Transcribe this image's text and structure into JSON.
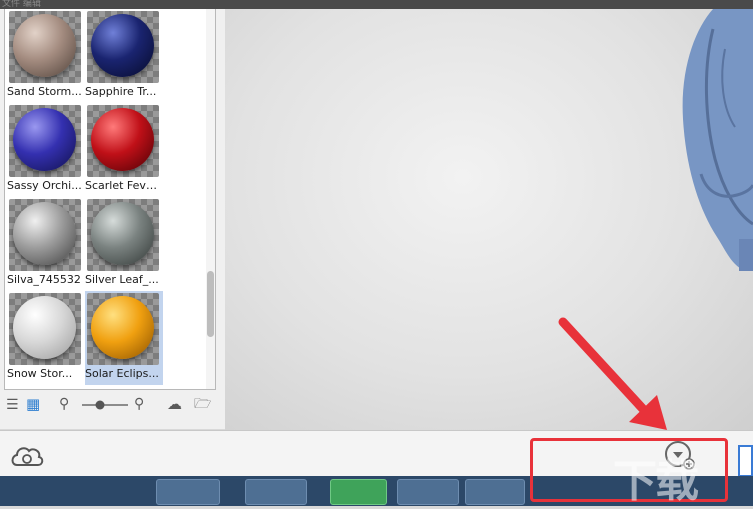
{
  "materials": [
    {
      "label": "Sand Storm...",
      "colors": [
        "#e2d2c8",
        "#a48c80",
        "#4e4038"
      ]
    },
    {
      "label": "Sapphire Tr...",
      "colors": [
        "#7080d8",
        "#1a2470",
        "#060a28"
      ]
    },
    {
      "label": "Sassy Orchi...",
      "colors": [
        "#9a98f0",
        "#3430b0",
        "#10104a"
      ]
    },
    {
      "label": "Scarlet Feve...",
      "colors": [
        "#ff7a7a",
        "#c01018",
        "#4a0004"
      ]
    },
    {
      "label": "Silva_745532",
      "colors": [
        "#f0f0f0",
        "#9c9c9c",
        "#3e3e3e"
      ]
    },
    {
      "label": "Silver Leaf_...",
      "colors": [
        "#d6dcda",
        "#7a8280",
        "#303634"
      ]
    },
    {
      "label": "Snow Stor...",
      "colors": [
        "#ffffff",
        "#d8d8d8",
        "#9a9a9a"
      ]
    },
    {
      "label": "Solar Eclips...",
      "colors": [
        "#ffe080",
        "#f0a010",
        "#8a5000"
      ]
    }
  ],
  "selected_material": "Solar Eclips...",
  "bottom_bar": {
    "cloud_label": "云库",
    "import_label": "导入"
  },
  "colors": {
    "annotation_red": "#e8323a",
    "selection": "#c2d4ee",
    "model_blue": "#7896c4"
  }
}
